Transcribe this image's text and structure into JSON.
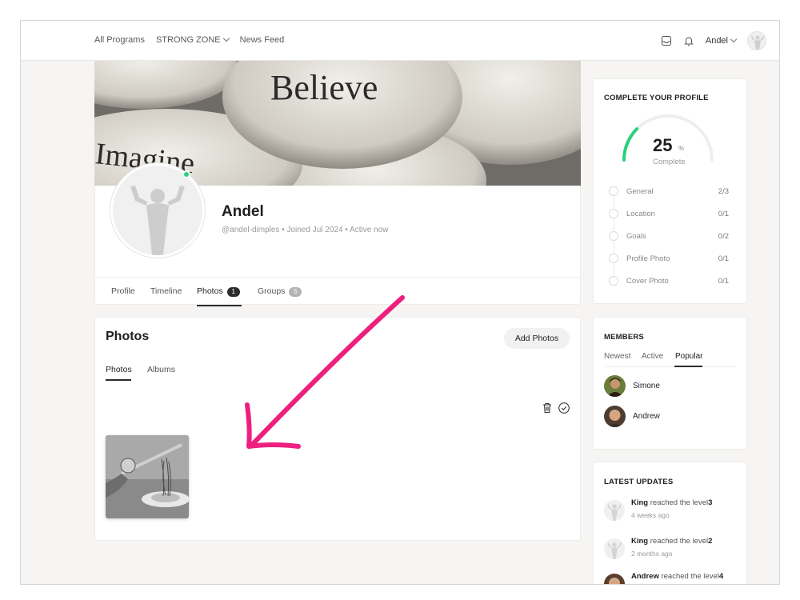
{
  "topbar": {
    "nav": [
      "All Programs",
      "STRONG ZONE",
      "News Feed"
    ],
    "user_name": "Andel"
  },
  "profile": {
    "cover_words": [
      "Believe",
      "Imagine"
    ],
    "name": "Andel",
    "meta": "@andel-dimples • Joined Jul 2024 • Active now",
    "status_color": "#2ad07f",
    "tabs": [
      {
        "label": "Profile"
      },
      {
        "label": "Timeline"
      },
      {
        "label": "Photos",
        "count": "1"
      },
      {
        "label": "Groups",
        "count": "5"
      }
    ]
  },
  "photos": {
    "title": "Photos",
    "add_label": "Add Photos",
    "subtabs": [
      "Photos",
      "Albums"
    ]
  },
  "complete_profile": {
    "title": "COMPLETE YOUR PROFILE",
    "percent": "25",
    "percent_sign": "%",
    "label": "Complete",
    "accent": "#2ad07f",
    "steps": [
      {
        "label": "General",
        "count": "2/3"
      },
      {
        "label": "Location",
        "count": "0/1"
      },
      {
        "label": "Goals",
        "count": "0/2"
      },
      {
        "label": "Profile Photo",
        "count": "0/1"
      },
      {
        "label": "Cover Photo",
        "count": "0/1"
      }
    ]
  },
  "members": {
    "title": "MEMBERS",
    "tabs": [
      "Newest",
      "Active",
      "Popular"
    ],
    "list": [
      "Simone",
      "Andrew"
    ]
  },
  "latest_updates": {
    "title": "LATEST UPDATES",
    "items": [
      {
        "name": "King",
        "action": " reached the level",
        "level": "3",
        "time": "4 weeks ago"
      },
      {
        "name": "King",
        "action": " reached the level",
        "level": "2",
        "time": "2 months ago"
      },
      {
        "name": "Andrew",
        "action": " reached the level",
        "level": "4",
        "time": ""
      }
    ]
  },
  "annotation_color": "#ee1f7f"
}
